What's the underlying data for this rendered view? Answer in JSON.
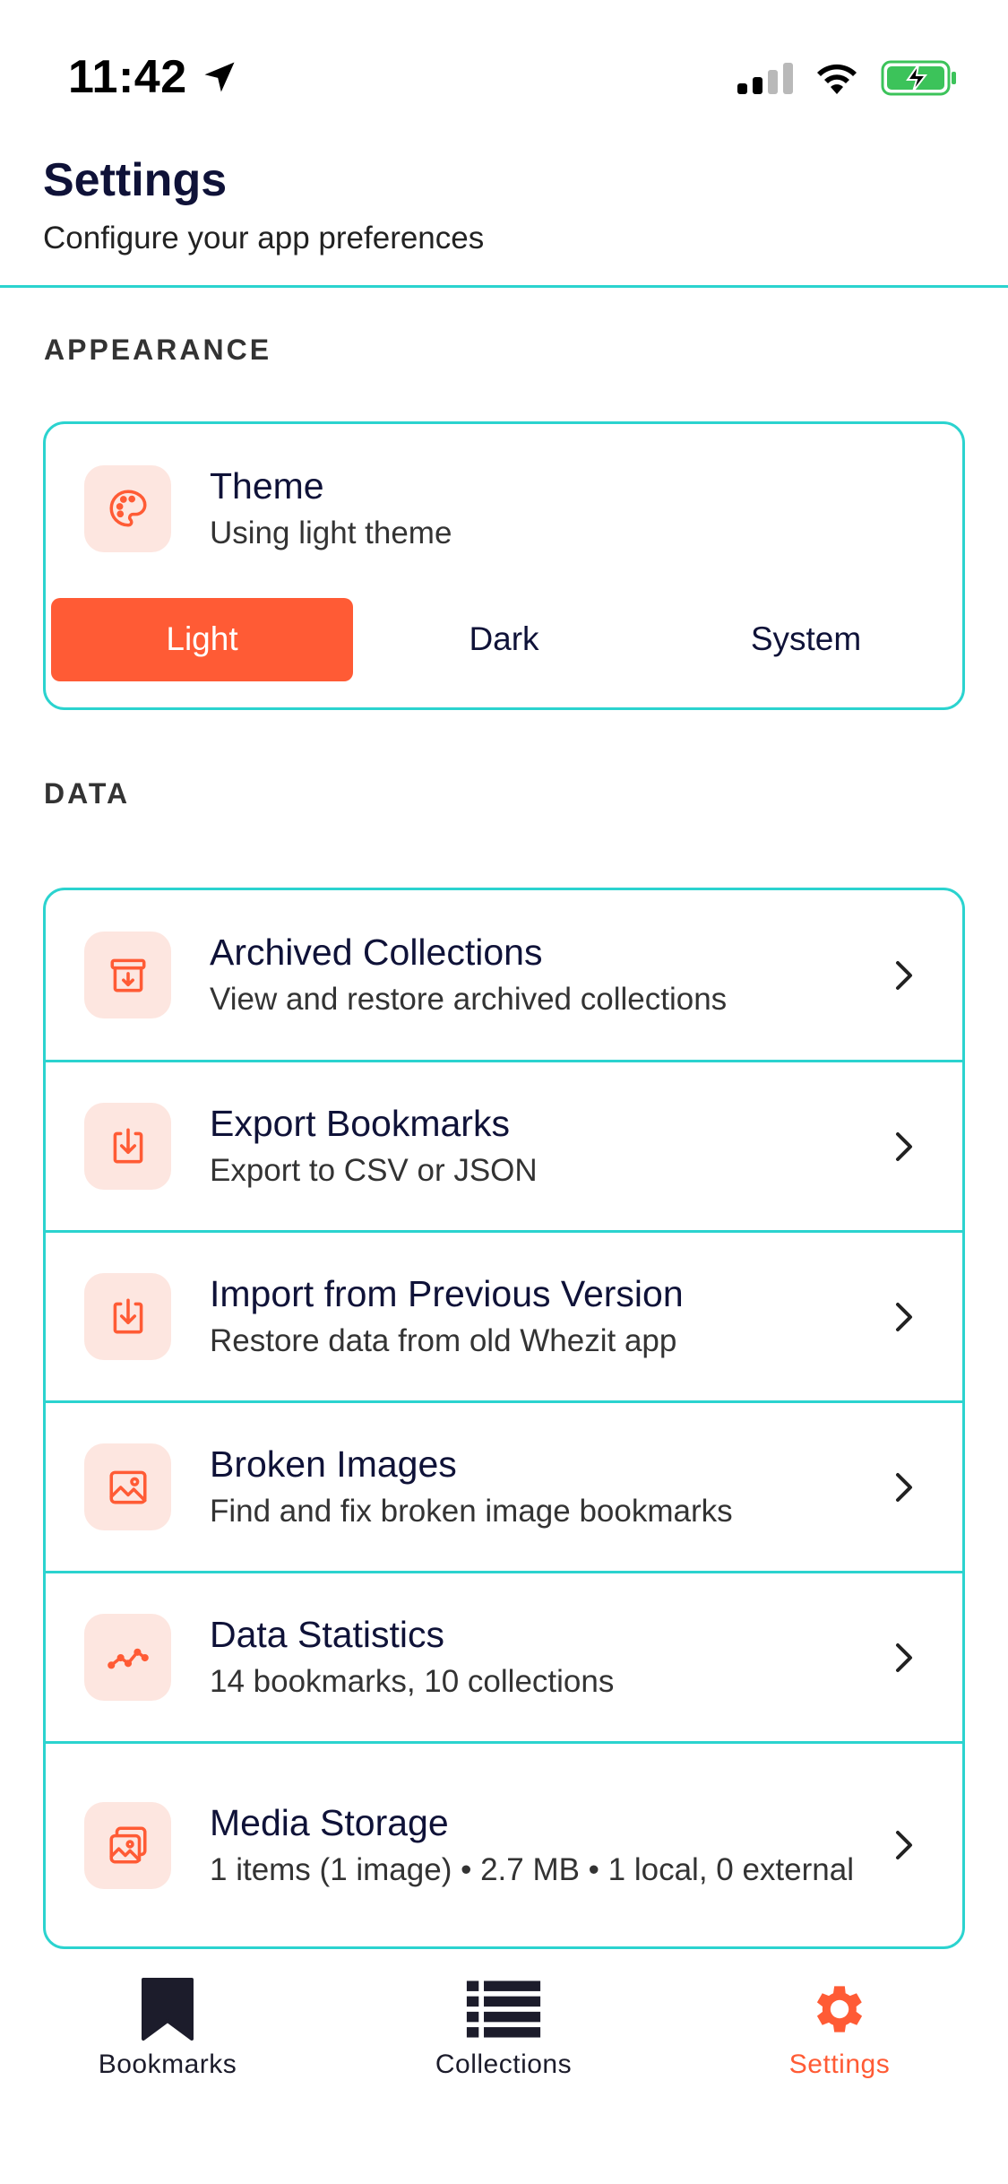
{
  "status_bar": {
    "time": "11:42"
  },
  "header": {
    "title": "Settings",
    "subtitle": "Configure your app preferences"
  },
  "appearance": {
    "section_label": "APPEARANCE",
    "theme": {
      "title": "Theme",
      "subtitle": "Using light theme",
      "icon": "palette-icon",
      "options": [
        "Light",
        "Dark",
        "System"
      ],
      "selected": "Light"
    }
  },
  "data_section": {
    "section_label": "DATA",
    "items": [
      {
        "title": "Archived Collections",
        "subtitle": "View and restore archived collections",
        "icon": "archive-icon"
      },
      {
        "title": "Export Bookmarks",
        "subtitle": "Export to CSV or JSON",
        "icon": "download-icon"
      },
      {
        "title": "Import from Previous Version",
        "subtitle": "Restore data from old Whezit app",
        "icon": "download-icon"
      },
      {
        "title": "Broken Images",
        "subtitle": "Find and fix broken image bookmarks",
        "icon": "image-icon"
      },
      {
        "title": "Data Statistics",
        "subtitle": "14 bookmarks, 10 collections",
        "icon": "trend-icon"
      },
      {
        "title": "Media Storage",
        "subtitle": "1 items (1 image) • 2.7 MB • 1 local, 0 external",
        "icon": "images-icon"
      }
    ]
  },
  "tab_bar": {
    "tabs": [
      {
        "label": "Bookmarks",
        "icon": "bookmark-icon",
        "active": false
      },
      {
        "label": "Collections",
        "icon": "list-icon",
        "active": false
      },
      {
        "label": "Settings",
        "icon": "gear-icon",
        "active": true
      }
    ]
  },
  "colors": {
    "accent": "#ff5b35",
    "border": "#2bd3cf",
    "icon_bg": "#fde6e0",
    "text": "#0f1238"
  }
}
